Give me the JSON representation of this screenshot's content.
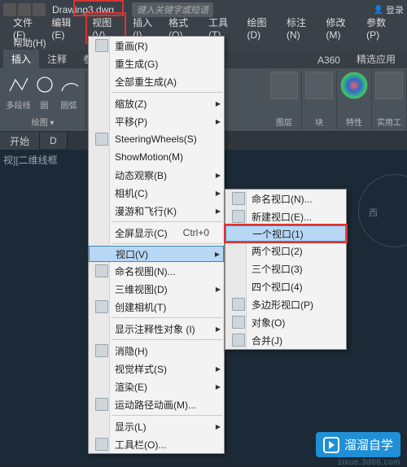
{
  "titlebar": {
    "filename": "Drawing3.dwg",
    "search_placeholder": "键入关键字或短语",
    "login": "登录"
  },
  "menubar": {
    "items": [
      "文件(F)",
      "编辑(E)",
      "视图(V)",
      "插入(I)",
      "格式(O)",
      "工具(T)",
      "绘图(D)",
      "标注(N)",
      "修改(M)",
      "参数(P)"
    ],
    "help": "帮助(H)"
  },
  "ribbon_tabs": {
    "items": [
      "插入",
      "注释",
      "参数"
    ],
    "right": [
      "A360",
      "精选应用"
    ]
  },
  "ribbon_panels": {
    "p0": {
      "label": "绘图 ▾",
      "tools": [
        "多段线",
        "圆",
        "圆弧"
      ]
    },
    "p1": {
      "label": "图层"
    },
    "p2": {
      "label": "块"
    },
    "p3": {
      "label": "特性"
    },
    "p4": {
      "label": "实用工"
    }
  },
  "doctabs": {
    "t0": "开始",
    "t1": "D"
  },
  "viewport_label": "视][二维线框",
  "nav_dir": "西",
  "view_menu": [
    {
      "t": "重画(R)",
      "icon": true
    },
    {
      "t": "重生成(G)"
    },
    {
      "t": "全部重生成(A)"
    },
    {
      "sep": true
    },
    {
      "t": "缩放(Z)",
      "sub": true
    },
    {
      "t": "平移(P)",
      "sub": true
    },
    {
      "t": "SteeringWheels(S)",
      "icon": true
    },
    {
      "t": "ShowMotion(M)"
    },
    {
      "t": "动态观察(B)",
      "sub": true
    },
    {
      "t": "相机(C)",
      "sub": true
    },
    {
      "t": "漫游和飞行(K)",
      "sub": true
    },
    {
      "sep": true
    },
    {
      "t": "全屏显示(C)",
      "sc": "Ctrl+0"
    },
    {
      "sep": true
    },
    {
      "t": "视口(V)",
      "sub": true,
      "hl": true
    },
    {
      "t": "命名视图(N)...",
      "icon": true
    },
    {
      "t": "三维视图(D)",
      "sub": true
    },
    {
      "t": "创建相机(T)",
      "icon": true
    },
    {
      "sep": true
    },
    {
      "t": "显示注释性对象 (I)",
      "sub": true
    },
    {
      "sep": true
    },
    {
      "t": "消隐(H)",
      "icon": true
    },
    {
      "t": "视觉样式(S)",
      "sub": true
    },
    {
      "t": "渲染(E)",
      "sub": true
    },
    {
      "t": "运动路径动画(M)...",
      "icon": true
    },
    {
      "sep": true
    },
    {
      "t": "显示(L)",
      "sub": true
    },
    {
      "t": "工具栏(O)...",
      "icon": true
    }
  ],
  "viewport_submenu": [
    {
      "t": "命名视口(N)...",
      "icon": true
    },
    {
      "t": "新建视口(E)...",
      "icon": true
    },
    {
      "t": "一个视口(1)",
      "hl": true,
      "boxed": true
    },
    {
      "t": "两个视口(2)"
    },
    {
      "t": "三个视口(3)"
    },
    {
      "t": "四个视口(4)"
    },
    {
      "t": "多边形视口(P)",
      "icon": true
    },
    {
      "t": "对象(O)",
      "icon": true
    },
    {
      "t": "合并(J)",
      "icon": true
    }
  ],
  "watermark": {
    "text": "溜溜自学",
    "url": "zixue.3d66.com"
  }
}
